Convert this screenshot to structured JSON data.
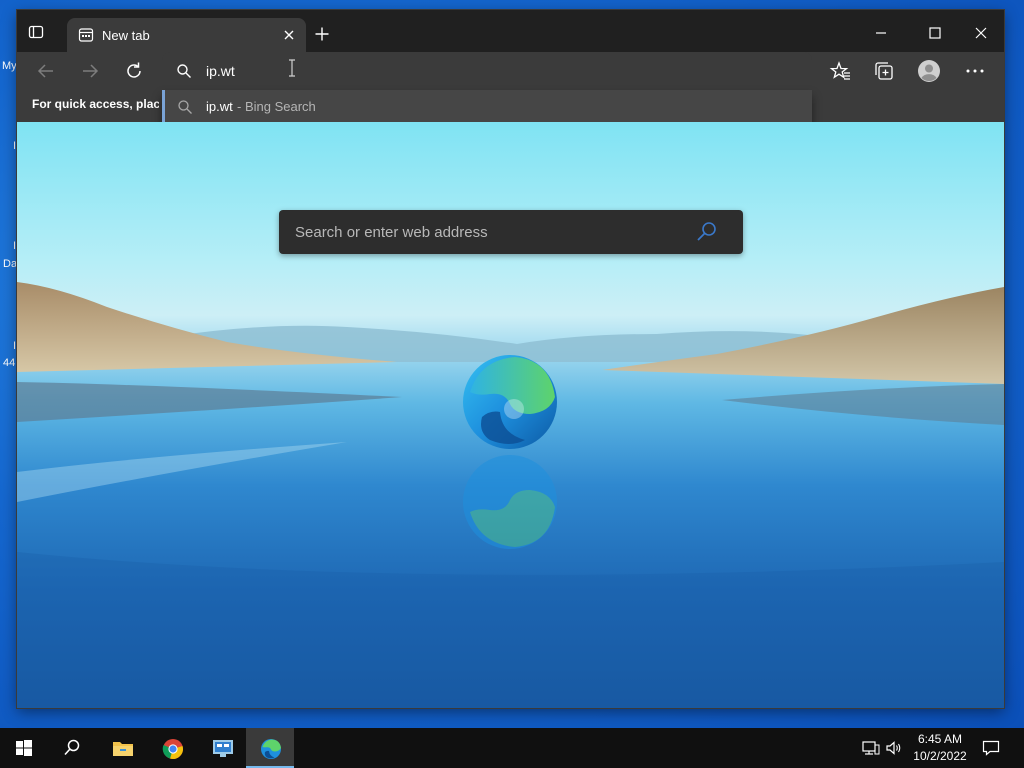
{
  "desktop": {
    "fragments": [
      "My",
      "I",
      "I",
      "Da",
      "I",
      "44"
    ]
  },
  "browser": {
    "tab": {
      "title": "New tab"
    },
    "address": {
      "value": "ip.wt"
    },
    "favorites_bar": {
      "text": "For quick access, place y"
    },
    "suggestion": {
      "query": "ip.wt",
      "source": " - Bing Search"
    },
    "page": {
      "search_placeholder": "Search or enter web address"
    }
  },
  "taskbar": {
    "time": "6:45 AM",
    "date": "10/2/2022"
  },
  "colors": {
    "accent": "#76b9ed",
    "window_bg": "#202020",
    "toolbar_bg": "#3b3b3b"
  }
}
